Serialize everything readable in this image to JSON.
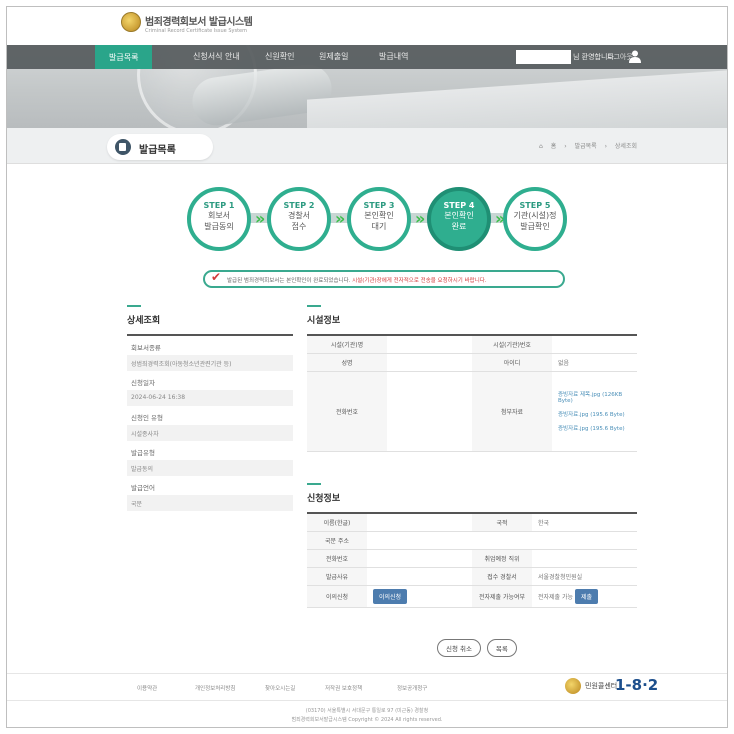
{
  "header": {
    "site_title": "범죄경력회보서 발급시스템",
    "site_subtitle": "Criminal Record Certificate Issue System",
    "nav": [
      {
        "label": "발급목록"
      },
      {
        "label": "신청서식 안내"
      },
      {
        "label": "신원확인"
      },
      {
        "label": "원제출일"
      },
      {
        "label": "발급내역"
      }
    ],
    "greeting": "님 환영합니다.",
    "logout": "로그아웃"
  },
  "page": {
    "title": "발급목록",
    "breadcrumb": [
      "홈",
      "발급목록",
      "상세조회"
    ]
  },
  "steps": [
    {
      "step": "STEP 1",
      "desc1": "회보서",
      "desc2": "발급동의"
    },
    {
      "step": "STEP 2",
      "desc1": "경찰서",
      "desc2": "접수"
    },
    {
      "step": "STEP 3",
      "desc1": "본인확인",
      "desc2": "대기"
    },
    {
      "step": "STEP 4",
      "desc1": "본인확인",
      "desc2": "완료"
    },
    {
      "step": "STEP 5",
      "desc1": "기관(시설)정",
      "desc2": "발급확인"
    }
  ],
  "notice": {
    "text": "발급된 범죄경력회보서는 본인확인이 완료되었습니다.",
    "highlight": "시설(기관)장에게 전자적으로 전송을 요청하시기 바랍니다."
  },
  "detail": {
    "title": "상세조회",
    "items": [
      {
        "label": "회보서종류",
        "value": "성범죄경력조회(아동청소년관련기관 등)"
      },
      {
        "label": "신청일자",
        "value": "2024-06-24 16:38"
      },
      {
        "label": "신청인 유형",
        "value": "시설종사자"
      },
      {
        "label": "발급유형",
        "value": "발급동의"
      },
      {
        "label": "발급언어",
        "value": "국문"
      }
    ]
  },
  "facility": {
    "title": "시설정보",
    "rows": [
      {
        "k1": "시설(기관)명",
        "v1": "",
        "k2": "시설(기관)번호",
        "v2": ""
      },
      {
        "k1": "성명",
        "v1": "",
        "k2": "아이디",
        "v2": "없음"
      }
    ],
    "phone_label": "전화번호",
    "attach_label": "첨부자료",
    "files": [
      "증빙자료 제목.jpg (126KB Byte)",
      "증빙자료.jpg (195.6 Byte)",
      "증빙자료.jpg (195.6 Byte)"
    ]
  },
  "applicant": {
    "title": "신청정보",
    "rows": [
      {
        "k1": "이름(한글)",
        "v1": "",
        "k2": "국적",
        "v2": "한국"
      },
      {
        "k1": "국문 주소",
        "v1": "",
        "k2": "",
        "v2": ""
      },
      {
        "k1": "전화번호",
        "v1": "",
        "k2": "취업예정 직위",
        "v2": ""
      },
      {
        "k1": "발급사유",
        "v1": "",
        "k2": "접수 경찰서",
        "v2": "서울경찰청민원실"
      },
      {
        "k1": "이의신청",
        "v1": "",
        "k2": "전자제출 가능여부",
        "v2": "전자제출 가능"
      }
    ],
    "objection_btn": "이의신청",
    "submit_btn": "제출"
  },
  "buttons": {
    "cancel": "신청 취소",
    "list": "목록"
  },
  "footer": {
    "links": [
      "이용약관",
      "개인정보처리방침",
      "찾아오시는길",
      "저작권 보호정책",
      "정보공개청구"
    ],
    "logo_label": "민원콜센터",
    "phone": "1-8·2",
    "addr": "(03170) 서울특별시 서대문구 통일로 97 (미근동) 경찰청",
    "copyright": "범죄경력회보서발급시스템 Copyright © 2024 All rights reserved."
  }
}
